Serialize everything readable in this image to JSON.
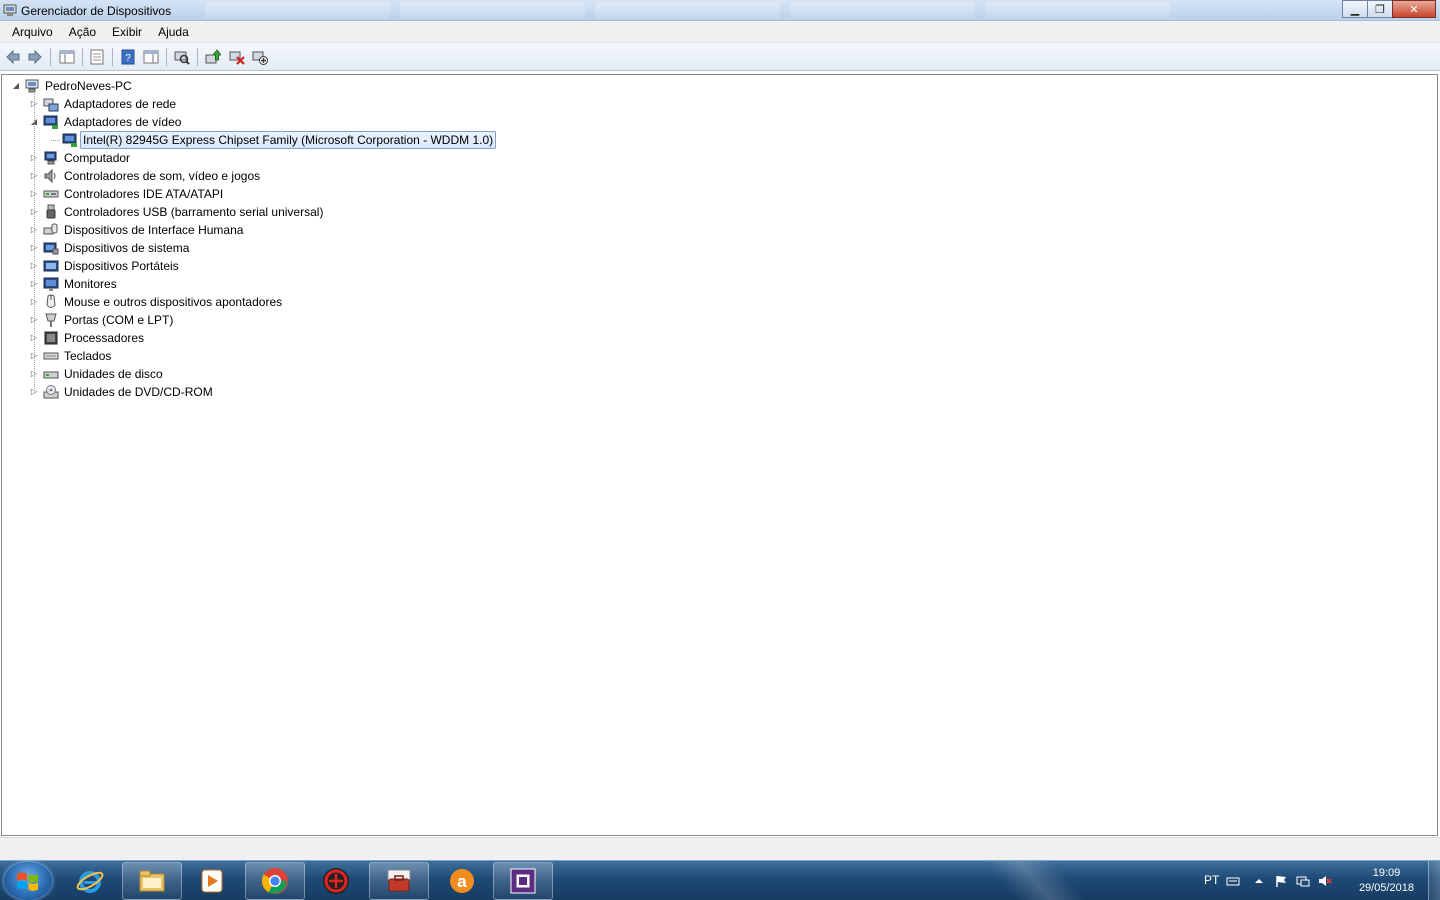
{
  "window": {
    "title": "Gerenciador de Dispositivos",
    "minimize_label": "▁",
    "maximize_label": "❐",
    "close_label": "✕"
  },
  "menu": [
    "Arquivo",
    "Ação",
    "Exibir",
    "Ajuda"
  ],
  "toolbar": [
    "back-icon",
    "forward-icon",
    "show-hide-console-tree-icon",
    "properties-icon",
    "help-icon",
    "show-action-pane-icon",
    "scan-hardware-icon",
    "update-driver-icon",
    "uninstall-device-icon",
    "disable-device-icon"
  ],
  "tree": {
    "root": "PedroNeves-PC",
    "categories": [
      {
        "label": "Adaptadores de rede",
        "icon": "network-adapter-icon",
        "expanded": false
      },
      {
        "label": "Adaptadores de vídeo",
        "icon": "display-adapter-icon",
        "expanded": true,
        "children": [
          {
            "label": "Intel(R) 82945G Express Chipset Family (Microsoft Corporation - WDDM 1.0)",
            "icon": "display-adapter-icon",
            "selected": true
          }
        ]
      },
      {
        "label": "Computador",
        "icon": "computer-icon",
        "expanded": false
      },
      {
        "label": "Controladores de som, vídeo e jogos",
        "icon": "speaker-icon",
        "expanded": false
      },
      {
        "label": "Controladores IDE ATA/ATAPI",
        "icon": "ide-controller-icon",
        "expanded": false
      },
      {
        "label": "Controladores USB (barramento serial universal)",
        "icon": "usb-icon",
        "expanded": false
      },
      {
        "label": "Dispositivos de Interface Humana",
        "icon": "hid-icon",
        "expanded": false
      },
      {
        "label": "Dispositivos de sistema",
        "icon": "system-device-icon",
        "expanded": false
      },
      {
        "label": "Dispositivos Portáteis",
        "icon": "portable-device-icon",
        "expanded": false
      },
      {
        "label": "Monitores",
        "icon": "monitor-icon",
        "expanded": false
      },
      {
        "label": "Mouse e outros dispositivos apontadores",
        "icon": "mouse-icon",
        "expanded": false
      },
      {
        "label": "Portas (COM e LPT)",
        "icon": "port-icon",
        "expanded": false
      },
      {
        "label": "Processadores",
        "icon": "processor-icon",
        "expanded": false
      },
      {
        "label": "Teclados",
        "icon": "keyboard-icon",
        "expanded": false
      },
      {
        "label": "Unidades de disco",
        "icon": "disk-drive-icon",
        "expanded": false
      },
      {
        "label": "Unidades de DVD/CD-ROM",
        "icon": "dvd-drive-icon",
        "expanded": false
      }
    ]
  },
  "taskbar": {
    "apps": [
      "internet-explorer-icon",
      "file-explorer-icon",
      "media-player-icon",
      "chrome-icon",
      "malwarebytes-icon",
      "toolbox-icon",
      "avast-icon",
      "device-manager-icon"
    ],
    "language": "PT",
    "time": "19:09",
    "date": "29/05/2018"
  },
  "colors": {
    "accent": "#3f6f9c",
    "selection_border": "#7da2ce",
    "selection_fill": "#d9e7fa"
  }
}
